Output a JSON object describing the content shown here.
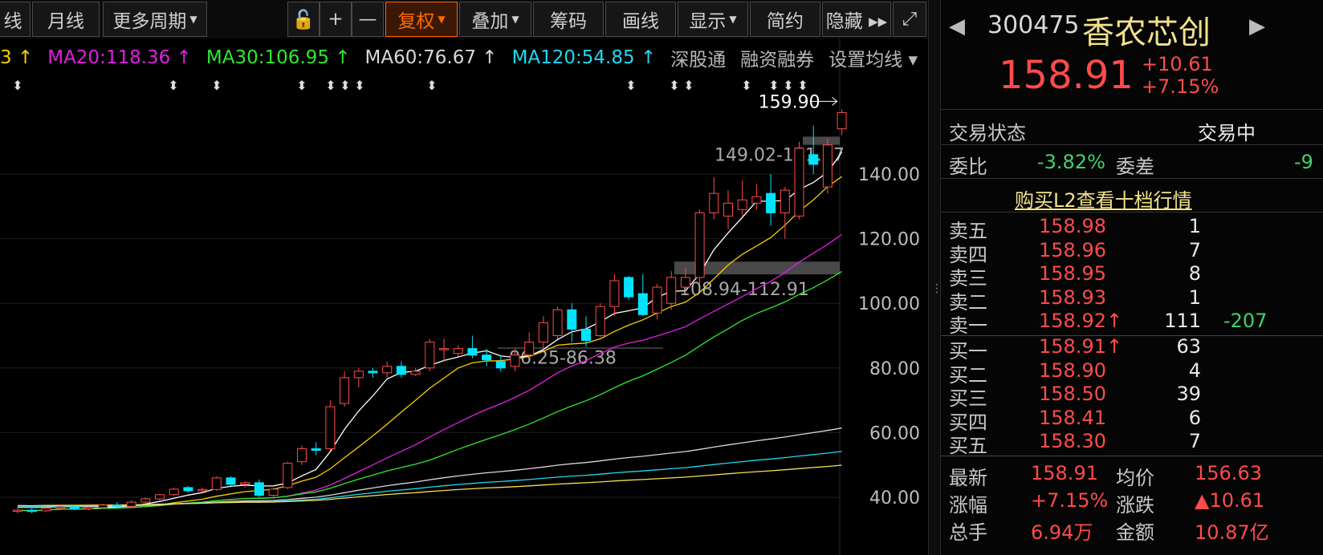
{
  "toolbar": {
    "buttons": [
      {
        "label": "线",
        "caret": false
      },
      {
        "label": "月线",
        "caret": false
      },
      {
        "label": "更多周期",
        "caret": true
      },
      {
        "label": "🔓",
        "caret": false
      },
      {
        "label": "+",
        "caret": false
      },
      {
        "label": "—",
        "caret": false
      },
      {
        "label": "复权",
        "caret": true,
        "active": true
      },
      {
        "label": "叠加",
        "caret": true
      },
      {
        "label": "筹码",
        "caret": false
      },
      {
        "label": "画线",
        "caret": false
      },
      {
        "label": "显示",
        "caret": true
      },
      {
        "label": "简约",
        "caret": false
      },
      {
        "label": "隐藏 ▸▸",
        "caret": false
      },
      {
        "label": "⤢",
        "caret": false
      }
    ]
  },
  "ma_legend": [
    {
      "text": "3 ↑",
      "color": "#f5d000"
    },
    {
      "text": "MA20:118.36 ↑",
      "color": "#e020e0"
    },
    {
      "text": "MA30:106.95 ↑",
      "color": "#2ee82e"
    },
    {
      "text": "MA60:76.67 ↑",
      "color": "#d8d8d8"
    },
    {
      "text": "MA120:54.85 ↑",
      "color": "#20d8f0"
    },
    {
      "text": "深股通",
      "color": "#b8b8b8"
    },
    {
      "text": "融资融券",
      "color": "#b8b8b8"
    },
    {
      "text": "设置均线 ▾",
      "color": "#b8b8b8"
    }
  ],
  "chart_data": {
    "type": "candlestick",
    "y_ticks": [
      "140.00",
      "120.00",
      "100.00",
      "80.00",
      "60.00",
      "40.00"
    ],
    "y_tick_values": [
      140,
      120,
      100,
      80,
      60,
      40
    ],
    "ylim": [
      32,
      170
    ],
    "high_marker": "159.90",
    "zones": [
      {
        "label": "149.02-151.57",
        "low": 149.02,
        "high": 151.57
      },
      {
        "label": "108.94-112.91",
        "low": 108.94,
        "high": 112.91
      },
      {
        "label": "86.25-86.38",
        "low": 86.25,
        "high": 86.38
      }
    ],
    "colors": {
      "up": "#ff4b4b",
      "down": "#00e5ff",
      "ma5": "#ffffff",
      "ma10": "#f5d000",
      "ma20": "#e020e0",
      "ma30": "#2ee82e",
      "ma60": "#d8d8d8",
      "ma120": "#20d8f0",
      "ma250": "#f5e050"
    },
    "candles": [
      [
        36,
        37,
        35,
        36
      ],
      [
        36,
        36.5,
        35,
        35.6
      ],
      [
        35.8,
        37,
        35.5,
        36.6
      ],
      [
        36.6,
        37.5,
        36,
        37
      ],
      [
        37,
        37.3,
        36,
        36.4
      ],
      [
        36.4,
        37.2,
        36,
        36.8
      ],
      [
        36.8,
        38,
        36.5,
        37.6
      ],
      [
        37.6,
        38.5,
        37,
        37.2
      ],
      [
        37.2,
        39,
        36.8,
        38.5
      ],
      [
        38.5,
        40,
        38,
        39.5
      ],
      [
        39.5,
        41,
        39,
        40.8
      ],
      [
        40.8,
        43,
        40.5,
        42.5
      ],
      [
        43,
        43.5,
        41.5,
        42
      ],
      [
        42,
        43,
        41.5,
        42.4
      ],
      [
        42.4,
        46.5,
        42,
        46
      ],
      [
        46,
        46.5,
        43.5,
        44
      ],
      [
        44,
        45,
        43,
        44.5
      ],
      [
        44.5,
        45.5,
        40,
        40.6
      ],
      [
        40.6,
        43,
        40,
        42.5
      ],
      [
        43,
        51,
        42.5,
        50.5
      ],
      [
        51,
        56,
        50,
        55
      ],
      [
        55,
        57,
        53,
        54.5
      ],
      [
        55,
        70,
        54.5,
        68
      ],
      [
        69,
        79,
        68,
        77
      ],
      [
        77,
        80,
        74,
        79
      ],
      [
        79,
        80,
        77,
        78.5
      ],
      [
        78.5,
        82,
        77,
        80.5
      ],
      [
        80.5,
        82,
        77,
        78
      ],
      [
        78,
        80,
        77.5,
        79
      ],
      [
        80,
        89,
        79,
        88
      ],
      [
        86,
        89,
        82,
        86
      ],
      [
        84.5,
        87,
        83.5,
        86
      ],
      [
        86,
        90,
        83,
        84
      ],
      [
        84,
        86,
        80.5,
        82.5
      ],
      [
        82,
        84,
        79,
        80
      ],
      [
        80.5,
        86,
        79,
        84
      ],
      [
        84,
        91,
        83,
        88
      ],
      [
        88,
        96,
        86,
        94
      ],
      [
        90,
        99,
        89,
        98
      ],
      [
        98,
        100,
        88,
        92
      ],
      [
        92,
        96,
        86.5,
        88.5
      ],
      [
        90,
        100,
        89.5,
        99
      ],
      [
        99,
        109,
        96,
        107
      ],
      [
        108,
        108.5,
        101,
        102
      ],
      [
        103,
        109,
        96,
        96.5
      ],
      [
        97,
        106,
        95,
        105
      ],
      [
        100,
        110,
        98,
        108
      ],
      [
        105,
        111,
        103,
        108
      ],
      [
        108,
        129,
        106,
        128
      ],
      [
        128,
        139,
        126,
        134
      ],
      [
        127,
        135,
        123,
        131
      ],
      [
        129,
        138,
        127,
        132
      ],
      [
        131,
        137,
        129,
        133
      ],
      [
        134,
        140,
        124,
        128
      ],
      [
        128,
        136,
        120,
        135
      ],
      [
        127,
        150,
        126,
        148
      ],
      [
        146,
        155,
        140,
        143
      ],
      [
        136,
        151,
        134,
        149
      ],
      [
        154,
        160,
        152,
        159
      ]
    ]
  },
  "quote": {
    "code": "300475",
    "name": "香农芯创",
    "price": "158.91",
    "change": "+10.61",
    "change_pct": "+7.15%",
    "status_label": "交易状态",
    "status_value": "交易中",
    "webi_label": "委比",
    "webi_value": "-3.82%",
    "weicha_label": "委差",
    "weicha_value": "-9",
    "l2_link": "购买L2查看十档行情"
  },
  "order_book": {
    "asks": [
      {
        "label": "卖五",
        "price": "158.98",
        "vol": "1",
        "extra": ""
      },
      {
        "label": "卖四",
        "price": "158.96",
        "vol": "7",
        "extra": ""
      },
      {
        "label": "卖三",
        "price": "158.95",
        "vol": "8",
        "extra": ""
      },
      {
        "label": "卖二",
        "price": "158.93",
        "vol": "1",
        "extra": ""
      },
      {
        "label": "卖一",
        "price": "158.92↑",
        "vol": "111",
        "extra": "-207"
      }
    ],
    "bids": [
      {
        "label": "买一",
        "price": "158.91↑",
        "vol": "63",
        "extra": ""
      },
      {
        "label": "买二",
        "price": "158.90",
        "vol": "4",
        "extra": ""
      },
      {
        "label": "买三",
        "price": "158.50",
        "vol": "39",
        "extra": ""
      },
      {
        "label": "买四",
        "price": "158.41",
        "vol": "6",
        "extra": ""
      },
      {
        "label": "买五",
        "price": "158.30",
        "vol": "7",
        "extra": ""
      }
    ]
  },
  "stats": [
    {
      "l1": "最新",
      "v1": "158.91",
      "l2": "均价",
      "v2": "156.63"
    },
    {
      "l1": "涨幅",
      "v1": "+7.15%",
      "l2": "涨跌",
      "v2": "▲10.61"
    },
    {
      "l1": "总手",
      "v1": "6.94万",
      "l2": "金额",
      "v2": "10.87亿"
    }
  ]
}
